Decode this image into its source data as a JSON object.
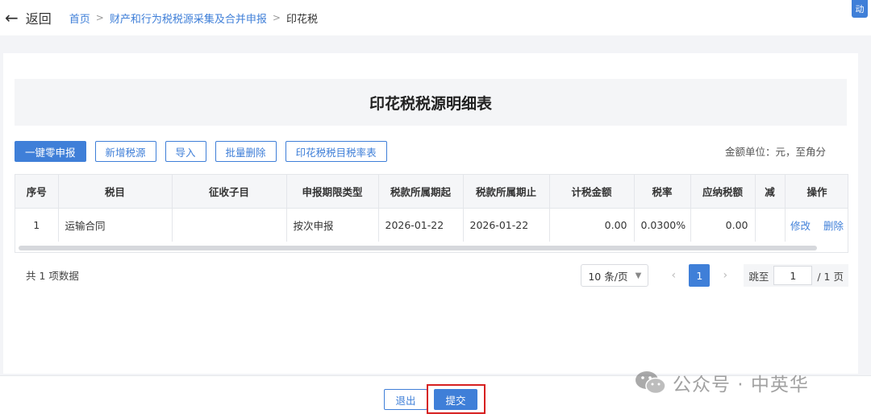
{
  "header": {
    "back_arrow": "←",
    "back_label": "返回",
    "breadcrumb": [
      "首页",
      "财产和行为税税源采集及合并申报",
      "印花税"
    ],
    "breadcrumb_sep": ">",
    "float_badge": "动"
  },
  "page": {
    "title": "印花税税源明细表",
    "unit_note": "金额单位：元，至角分"
  },
  "toolbar": {
    "buttons": [
      "一键零申报",
      "新增税源",
      "导入",
      "批量删除",
      "印花税税目税率表"
    ]
  },
  "table": {
    "columns": [
      "序号",
      "税目",
      "征收子目",
      "申报期限类型",
      "税款所属期起",
      "税款所属期止",
      "计税金额",
      "税率",
      "应纳税额",
      "减",
      "操作"
    ],
    "rows": [
      {
        "cells": [
          "1",
          "运输合同",
          "",
          "按次申报",
          "2026-01-22",
          "2026-01-22",
          "0.00",
          "0.0300%",
          "0.00",
          ""
        ],
        "actions": [
          "修改",
          "删除"
        ]
      }
    ]
  },
  "pagination": {
    "total_text": "共 1 项数据",
    "page_size": "10 条/页",
    "current_page": "1",
    "prev_icon": "‹",
    "next_icon": "›",
    "jump_label": "跳至",
    "jump_value": "1",
    "total_pages": "/ 1 页"
  },
  "footer": {
    "exit_label": "退出",
    "submit_label": "提交"
  },
  "watermark": {
    "text": "公众号 · 中英华"
  },
  "colors": {
    "primary": "#3f7fd8",
    "highlight_box": "#d62020",
    "page_bg": "#f3f4f7"
  }
}
